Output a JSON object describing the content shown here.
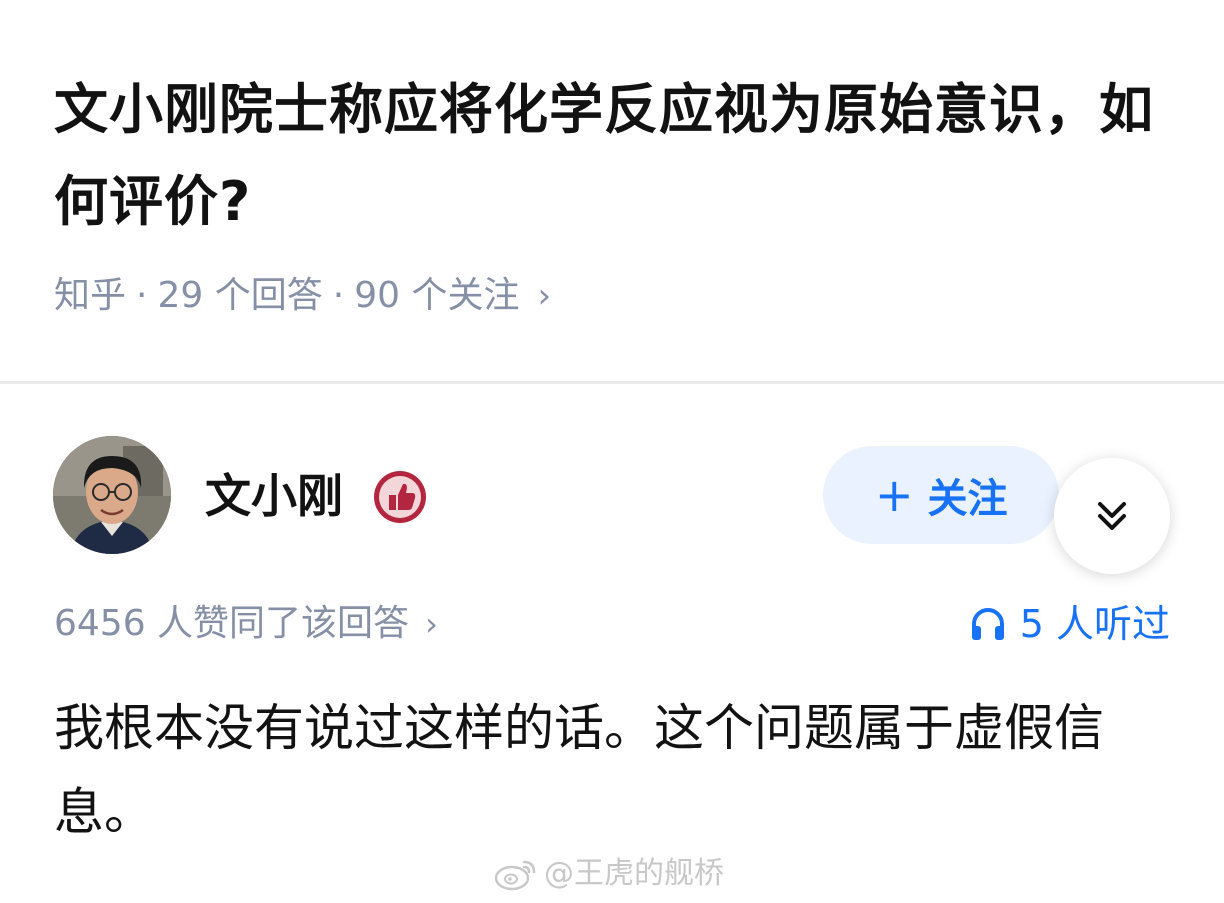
{
  "question": {
    "title": "文小刚院士称应将化学反应视为原始意识，如何评价?",
    "source": "知乎",
    "answers": "29 个回答",
    "followers": "90 个关注",
    "separator": "·"
  },
  "author": {
    "name": "文小刚",
    "follow_label": "关注",
    "badge_icon": "thumbs-up-badge",
    "collapse_icon": "double-chevron-down"
  },
  "answer": {
    "upvotes_text": "6456 人赞同了该回答",
    "listen_text": "5 人听过",
    "listen_icon": "headphones",
    "content": "我根本没有说过这样的话。这个问题属于虚假信息。"
  },
  "watermark": {
    "text": "@王虎的舰桥",
    "icon": "weibo-logo"
  },
  "colors": {
    "accent": "#1772f6",
    "meta": "#8590a6",
    "text": "#121212",
    "follow_bg": "#eaf2ff",
    "badge": "#b3263f"
  }
}
